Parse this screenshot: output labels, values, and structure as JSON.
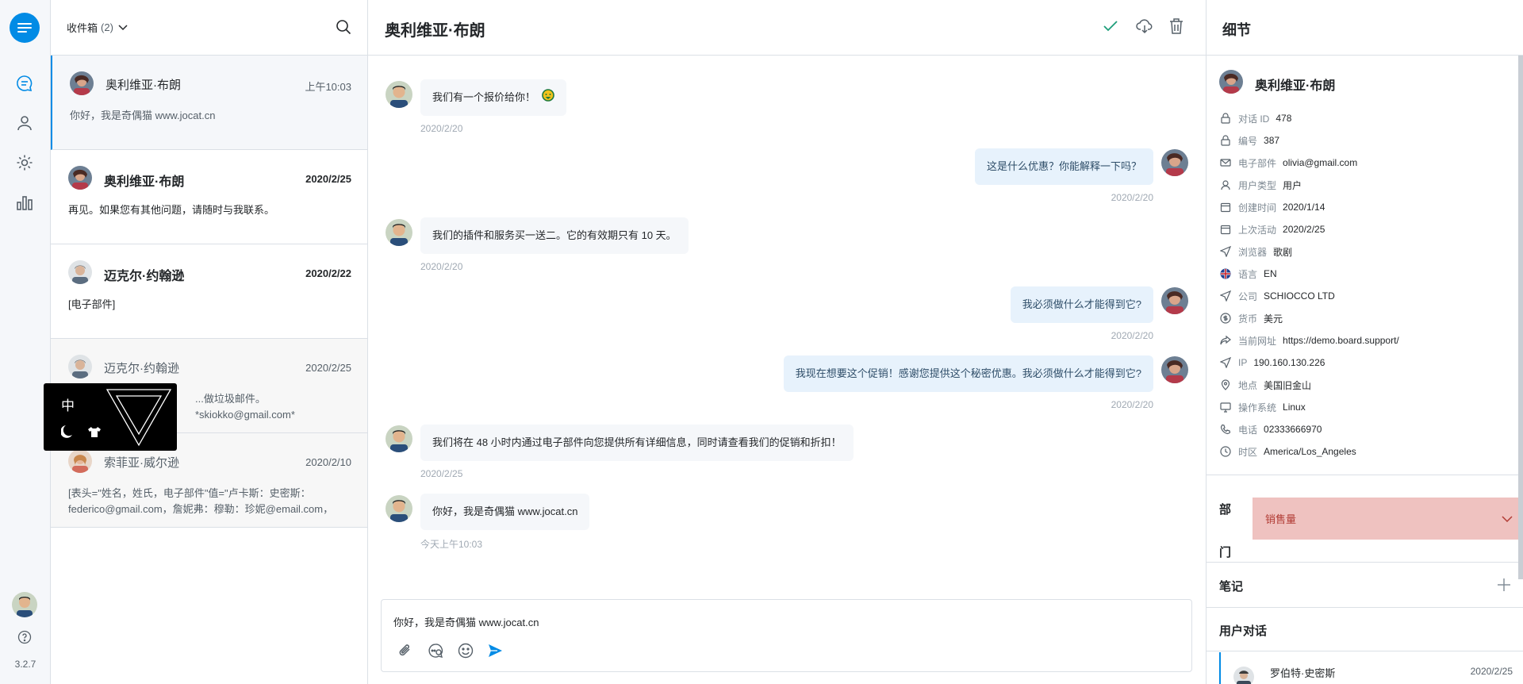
{
  "rail": {
    "version": "3.2.7",
    "nav": [
      "conversations-icon",
      "users-icon",
      "settings-icon",
      "reports-icon"
    ],
    "accent": "#028be5"
  },
  "list": {
    "title": "收件箱",
    "count": "(2)",
    "conversations": [
      {
        "name": "奥利维亚·布朗",
        "date": "上午10:03",
        "message": "你好，我是奇偶猫 www.jocat.cn"
      },
      {
        "name": "奥利维亚·布朗",
        "date": "2020/2/25",
        "message": "再见。如果您有其他问题，请随时与我联系。"
      },
      {
        "name": "迈克尔·约翰逊",
        "date": "2020/2/22",
        "message": "[电子部件]"
      },
      {
        "name": "迈克尔·约翰逊",
        "date": "2020/2/25",
        "message": "...做垃圾邮件。*skiokko@gmail.com*"
      },
      {
        "name": "索菲亚·威尔逊",
        "date": "2020/2/10",
        "message": "[表头=\"姓名，姓氏，电子部件\"值=\"卢卡斯：史密斯：federico@gmail.com，詹妮弗：穆勒：珍妮@email.com，"
      }
    ]
  },
  "ime": {
    "label": "中"
  },
  "chat": {
    "title": "奥利维亚·布朗",
    "messages": [
      {
        "text": "我们有一个报价给你！",
        "time": "2020/2/20"
      },
      {
        "text": "这是什么优惠？你能解释一下吗？",
        "time": "2020/2/20"
      },
      {
        "text": "我们的插件和服务买一送二。它的有效期只有 10 天。",
        "time": "2020/2/20"
      },
      {
        "text": "我必须做什么才能得到它?",
        "time": "2020/2/20"
      },
      {
        "text": "我现在想要这个促销！感谢您提供这个秘密优惠。我必须做什么才能得到它?",
        "time": "2020/2/20"
      },
      {
        "text": "我们将在 48 小时内通过电子部件向您提供所有详细信息，同时请查看我们的促销和折扣！",
        "time": "2020/2/25"
      },
      {
        "text": "你好，我是奇偶猫 www.jocat.cn",
        "time": "今天上午10:03"
      }
    ],
    "composer_value": "你好，我是奇偶猫 www.jocat.cn"
  },
  "details": {
    "title": "细节",
    "user_name": "奥利维亚·布朗",
    "fields": [
      {
        "icon": "lock-icon",
        "label": "对话 ID",
        "value": "478"
      },
      {
        "icon": "lock-icon",
        "label": "编号",
        "value": "387"
      },
      {
        "icon": "envelope-icon",
        "label": "电子部件",
        "value": "olivia@gmail.com"
      },
      {
        "icon": "user-icon",
        "label": "用户类型",
        "value": "用户"
      },
      {
        "icon": "calendar-icon",
        "label": "创建时间",
        "value": "2020/1/14"
      },
      {
        "icon": "calendar-icon",
        "label": "上次活动",
        "value": "2020/2/25"
      },
      {
        "icon": "send-icon",
        "label": "浏览器",
        "value": "歌剧"
      },
      {
        "icon": "flag-uk-icon",
        "label": "语言",
        "value": "EN"
      },
      {
        "icon": "send-icon",
        "label": "公司",
        "value": "SCHIOCCO LTD"
      },
      {
        "icon": "currency-icon",
        "label": "货币",
        "value": "美元"
      },
      {
        "icon": "share-icon",
        "label": "当前网址",
        "value": "https://demo.board.support/"
      },
      {
        "icon": "send-icon",
        "label": "IP",
        "value": "190.160.130.226"
      },
      {
        "icon": "location-pin-icon",
        "label": "地点",
        "value": "美国旧金山"
      },
      {
        "icon": "monitor-icon",
        "label": "操作系统",
        "value": "Linux"
      },
      {
        "icon": "phone-icon",
        "label": "电话",
        "value": "02333666970"
      },
      {
        "icon": "clock-icon",
        "label": "时区",
        "value": "America/Los_Angeles"
      }
    ],
    "department_label": "部门",
    "department_value": "销售量",
    "notes_label": "笔记",
    "user_conversations_label": "用户对话",
    "user_conversation": {
      "name": "罗伯特·史密斯",
      "date": "2020/2/25"
    }
  }
}
